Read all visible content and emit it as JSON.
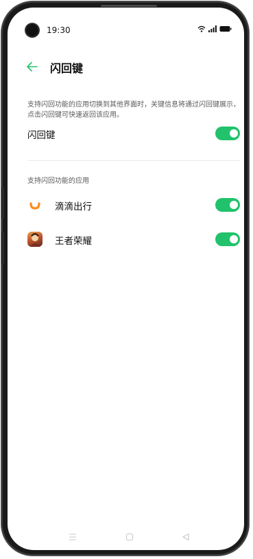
{
  "status_bar": {
    "time": "19:30"
  },
  "header": {
    "title": "闪回键"
  },
  "description": "支持闪回功能的应用切换到其他界面时，关键信息将通过闪回键展示，点击闪回键可快速返回该应用。",
  "main_toggle": {
    "label": "闪回键",
    "state": "on"
  },
  "section": {
    "header": "支持闪回功能的应用"
  },
  "apps": [
    {
      "label": "滴滴出行",
      "icon": "didi-icon",
      "state": "on"
    },
    {
      "label": "王者荣耀",
      "icon": "honor-of-kings-icon",
      "state": "on"
    }
  ],
  "colors": {
    "accent": "#21C26B",
    "back_arrow": "#21C26B",
    "text": "#111111",
    "secondary": "#5A5A5A",
    "didi_orange": "#FF8C1A"
  }
}
